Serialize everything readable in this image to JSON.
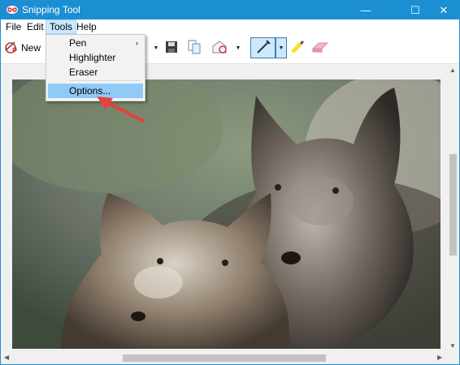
{
  "window": {
    "title": "Snipping Tool",
    "accent": "#1b8fd2"
  },
  "caption_buttons": {
    "minimize": "—",
    "maximize": "☐",
    "close": "✕"
  },
  "menubar": {
    "file": "File",
    "edit": "Edit",
    "tools": "Tools",
    "help": "Help"
  },
  "toolbar": {
    "new_label": "New"
  },
  "tools_menu": {
    "items": [
      {
        "label": "Pen",
        "submenu": "›"
      },
      {
        "label": "Highlighter"
      },
      {
        "label": "Eraser"
      },
      {
        "label": "Options...",
        "highlighted": true
      }
    ]
  },
  "icons": {
    "app": "scissors-icon",
    "new": "new-snip-icon",
    "save": "save-icon",
    "copy": "copy-icon",
    "send": "send-snip-icon",
    "pen": "pen-icon",
    "highlighter": "highlighter-icon",
    "eraser": "eraser-icon"
  },
  "annotation": {
    "arrow_color": "#e8403a"
  },
  "photo": {
    "subject": "two arctic fox cubs"
  }
}
